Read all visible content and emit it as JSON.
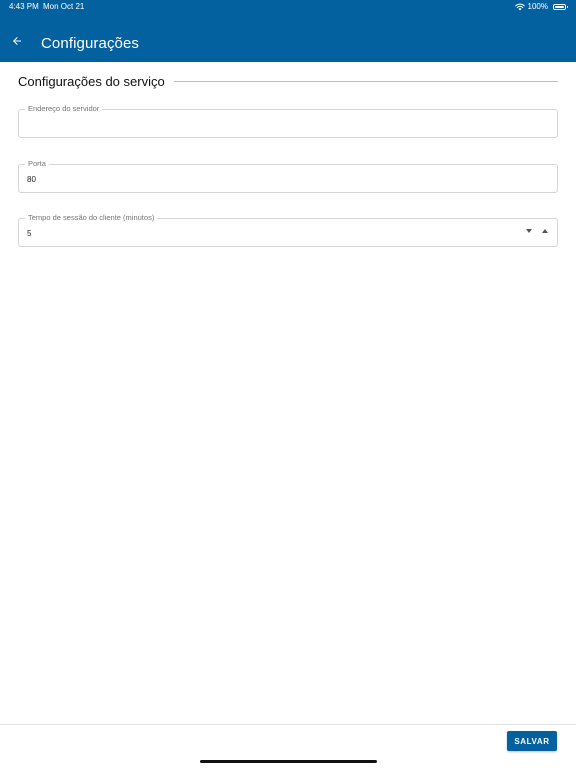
{
  "status_bar": {
    "time": "4:43 PM",
    "date": "Mon Oct 21",
    "battery": "100%"
  },
  "app_bar": {
    "title": "Configurações",
    "back_icon": "arrow-left-icon",
    "color": "#04619f"
  },
  "section": {
    "title": "Configurações do serviço"
  },
  "fields": {
    "server_address": {
      "label": "Endereço do servidor",
      "value": ""
    },
    "port": {
      "label": "Porta",
      "value": "80"
    },
    "session_timeout": {
      "label": "Tempo de sessão do cliente (minutos)",
      "value": "5"
    }
  },
  "footer": {
    "save_label": "SALVAR"
  }
}
